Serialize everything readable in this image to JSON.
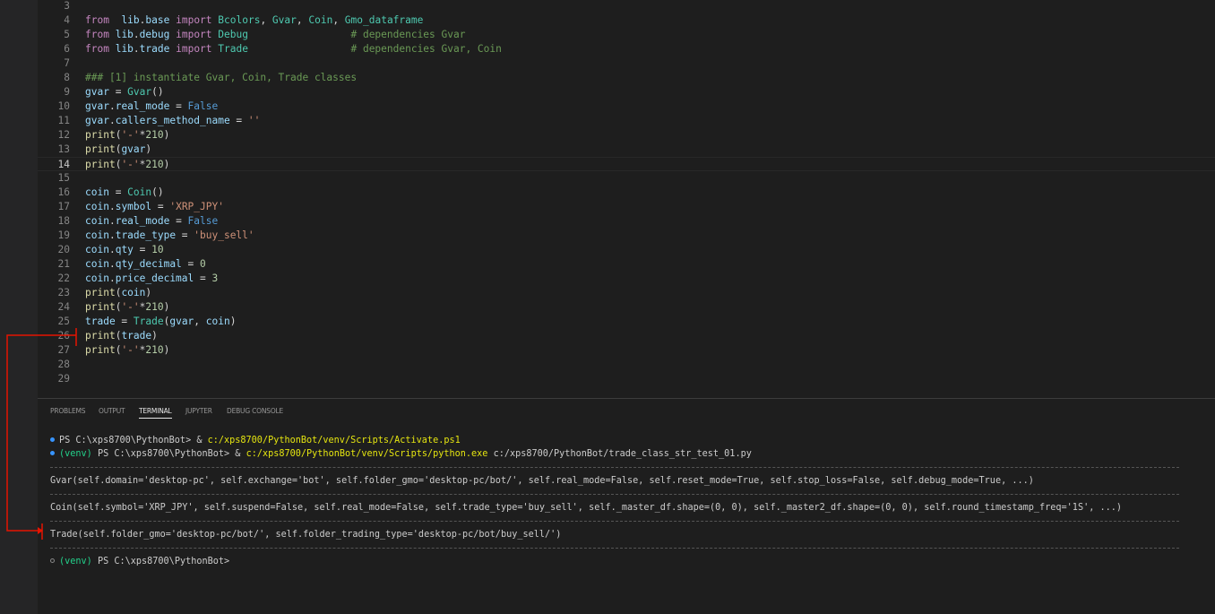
{
  "editor": {
    "lines": [
      {
        "n": "3",
        "tokens": []
      },
      {
        "n": "4",
        "tokens": [
          [
            "kw",
            "from"
          ],
          [
            "",
            "  "
          ],
          [
            "var",
            "lib"
          ],
          [
            "",
            "."
          ],
          [
            "var",
            "base"
          ],
          [
            "",
            " "
          ],
          [
            "kw",
            "import"
          ],
          [
            "",
            " "
          ],
          [
            "cls",
            "Bcolors"
          ],
          [
            "",
            ", "
          ],
          [
            "cls",
            "Gvar"
          ],
          [
            "",
            ", "
          ],
          [
            "cls",
            "Coin"
          ],
          [
            "",
            ", "
          ],
          [
            "cls",
            "Gmo_dataframe"
          ]
        ]
      },
      {
        "n": "5",
        "tokens": [
          [
            "kw",
            "from"
          ],
          [
            "",
            " "
          ],
          [
            "var",
            "lib"
          ],
          [
            "",
            "."
          ],
          [
            "var",
            "debug"
          ],
          [
            "",
            " "
          ],
          [
            "kw",
            "import"
          ],
          [
            "",
            " "
          ],
          [
            "cls",
            "Debug"
          ],
          [
            "",
            "                 "
          ],
          [
            "cmt",
            "# dependencies Gvar"
          ]
        ]
      },
      {
        "n": "6",
        "tokens": [
          [
            "kw",
            "from"
          ],
          [
            "",
            " "
          ],
          [
            "var",
            "lib"
          ],
          [
            "",
            "."
          ],
          [
            "var",
            "trade"
          ],
          [
            "",
            " "
          ],
          [
            "kw",
            "import"
          ],
          [
            "",
            " "
          ],
          [
            "cls",
            "Trade"
          ],
          [
            "",
            "                 "
          ],
          [
            "cmt",
            "# dependencies Gvar, Coin"
          ]
        ]
      },
      {
        "n": "7",
        "tokens": []
      },
      {
        "n": "8",
        "tokens": [
          [
            "cmt",
            "### [1] instantiate Gvar, Coin, Trade classes"
          ]
        ]
      },
      {
        "n": "9",
        "tokens": [
          [
            "var",
            "gvar"
          ],
          [
            "",
            " = "
          ],
          [
            "cls",
            "Gvar"
          ],
          [
            "",
            "()"
          ]
        ]
      },
      {
        "n": "10",
        "tokens": [
          [
            "var",
            "gvar"
          ],
          [
            "",
            "."
          ],
          [
            "var",
            "real_mode"
          ],
          [
            "",
            " = "
          ],
          [
            "const",
            "False"
          ]
        ]
      },
      {
        "n": "11",
        "tokens": [
          [
            "var",
            "gvar"
          ],
          [
            "",
            "."
          ],
          [
            "var",
            "callers_method_name"
          ],
          [
            "",
            " = "
          ],
          [
            "str",
            "''"
          ]
        ]
      },
      {
        "n": "12",
        "tokens": [
          [
            "fn",
            "print"
          ],
          [
            "",
            "("
          ],
          [
            "str",
            "'-'"
          ],
          [
            "",
            "*"
          ],
          [
            "num",
            "210"
          ],
          [
            "",
            ")"
          ]
        ]
      },
      {
        "n": "13",
        "tokens": [
          [
            "fn",
            "print"
          ],
          [
            "",
            "("
          ],
          [
            "var",
            "gvar"
          ],
          [
            "",
            ")"
          ]
        ]
      },
      {
        "n": "14",
        "tokens": [
          [
            "fn",
            "print"
          ],
          [
            "",
            "("
          ],
          [
            "str",
            "'-'"
          ],
          [
            "",
            "*"
          ],
          [
            "num",
            "210"
          ],
          [
            "",
            ")"
          ]
        ]
      },
      {
        "n": "15",
        "tokens": []
      },
      {
        "n": "16",
        "tokens": [
          [
            "var",
            "coin"
          ],
          [
            "",
            " = "
          ],
          [
            "cls",
            "Coin"
          ],
          [
            "",
            "()"
          ]
        ]
      },
      {
        "n": "17",
        "tokens": [
          [
            "var",
            "coin"
          ],
          [
            "",
            "."
          ],
          [
            "var",
            "symbol"
          ],
          [
            "",
            " = "
          ],
          [
            "str",
            "'XRP_JPY'"
          ]
        ]
      },
      {
        "n": "18",
        "tokens": [
          [
            "var",
            "coin"
          ],
          [
            "",
            "."
          ],
          [
            "var",
            "real_mode"
          ],
          [
            "",
            " = "
          ],
          [
            "const",
            "False"
          ]
        ]
      },
      {
        "n": "19",
        "tokens": [
          [
            "var",
            "coin"
          ],
          [
            "",
            "."
          ],
          [
            "var",
            "trade_type"
          ],
          [
            "",
            " = "
          ],
          [
            "str",
            "'buy_sell'"
          ]
        ]
      },
      {
        "n": "20",
        "tokens": [
          [
            "var",
            "coin"
          ],
          [
            "",
            "."
          ],
          [
            "var",
            "qty"
          ],
          [
            "",
            " = "
          ],
          [
            "num",
            "10"
          ]
        ]
      },
      {
        "n": "21",
        "tokens": [
          [
            "var",
            "coin"
          ],
          [
            "",
            "."
          ],
          [
            "var",
            "qty_decimal"
          ],
          [
            "",
            " = "
          ],
          [
            "num",
            "0"
          ]
        ]
      },
      {
        "n": "22",
        "tokens": [
          [
            "var",
            "coin"
          ],
          [
            "",
            "."
          ],
          [
            "var",
            "price_decimal"
          ],
          [
            "",
            " = "
          ],
          [
            "num",
            "3"
          ]
        ]
      },
      {
        "n": "23",
        "tokens": [
          [
            "fn",
            "print"
          ],
          [
            "",
            "("
          ],
          [
            "var",
            "coin"
          ],
          [
            "",
            ")"
          ]
        ]
      },
      {
        "n": "24",
        "tokens": [
          [
            "fn",
            "print"
          ],
          [
            "",
            "("
          ],
          [
            "str",
            "'-'"
          ],
          [
            "",
            "*"
          ],
          [
            "num",
            "210"
          ],
          [
            "",
            ")"
          ]
        ]
      },
      {
        "n": "25",
        "tokens": [
          [
            "var",
            "trade"
          ],
          [
            "",
            " = "
          ],
          [
            "cls",
            "Trade"
          ],
          [
            "",
            "("
          ],
          [
            "var",
            "gvar"
          ],
          [
            "",
            ", "
          ],
          [
            "var",
            "coin"
          ],
          [
            "",
            ")"
          ]
        ]
      },
      {
        "n": "26",
        "tokens": [
          [
            "fn",
            "print"
          ],
          [
            "",
            "("
          ],
          [
            "var",
            "trade"
          ],
          [
            "",
            ")"
          ]
        ]
      },
      {
        "n": "27",
        "tokens": [
          [
            "fn",
            "print"
          ],
          [
            "",
            "("
          ],
          [
            "str",
            "'-'"
          ],
          [
            "",
            "*"
          ],
          [
            "num",
            "210"
          ],
          [
            "",
            ")"
          ]
        ]
      },
      {
        "n": "28",
        "tokens": []
      },
      {
        "n": "29",
        "tokens": []
      }
    ],
    "active_line": "14"
  },
  "panel": {
    "tabs": [
      {
        "label": "PROBLEMS",
        "active": false
      },
      {
        "label": "OUTPUT",
        "active": false
      },
      {
        "label": "TERMINAL",
        "active": true
      },
      {
        "label": "JUPYTER",
        "active": false
      },
      {
        "label": "DEBUG CONSOLE",
        "active": false
      }
    ],
    "terminal": {
      "line1_prompt": "PS C:\\xps8700\\PythonBot> & ",
      "line1_cmd": "c:/xps8700/PythonBot/venv/Scripts/Activate.ps1",
      "line2_venv": "(venv)",
      "line2_prompt": " PS C:\\xps8700\\PythonBot> & ",
      "line2_cmd": "c:/xps8700/PythonBot/venv/Scripts/python.exe",
      "line2_arg": " c:/xps8700/PythonBot/trade_class_str_test_01.py",
      "gvar_out": "Gvar(self.domain='desktop-pc', self.exchange='bot', self.folder_gmo='desktop-pc/bot/', self.real_mode=False, self.reset_mode=True, self.stop_loss=False, self.debug_mode=True, ...)",
      "coin_out": "Coin(self.symbol='XRP_JPY', self.suspend=False, self.real_mode=False, self.trade_type='buy_sell', self._master_df.shape=(0, 0), self._master2_df.shape=(0, 0), self.round_timestamp_freq='1S', ...)",
      "trade_out": "Trade(self.folder_gmo='desktop-pc/bot/', self.folder_trading_type='desktop-pc/bot/buy_sell/')",
      "last_venv": "(venv)",
      "last_prompt": " PS C:\\xps8700\\PythonBot>"
    }
  },
  "colors": {
    "annotation": "#e51400"
  }
}
